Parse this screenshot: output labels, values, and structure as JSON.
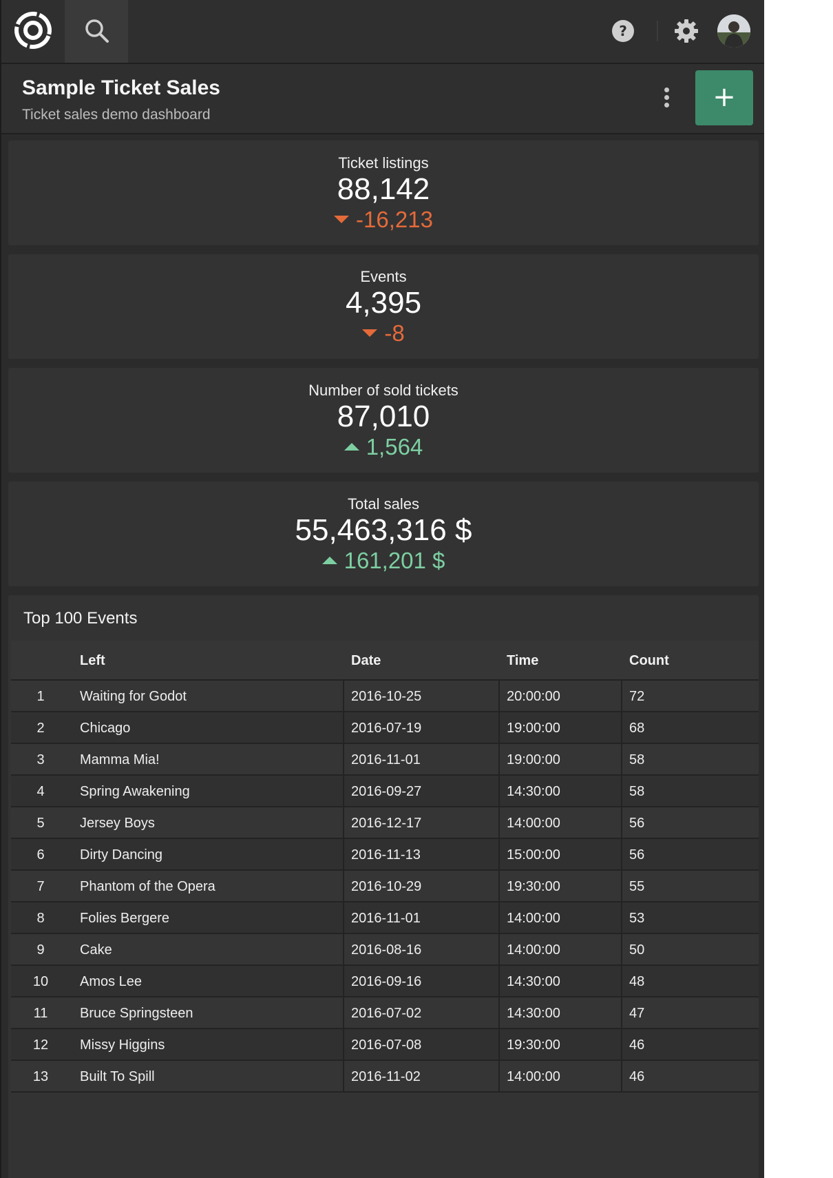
{
  "topbar": {
    "logo_icon": "app-logo-icon",
    "search_icon": "search-icon",
    "help_icon": "help-icon",
    "settings_icon": "gear-icon",
    "avatar_icon": "user-avatar"
  },
  "header": {
    "title": "Sample Ticket Sales",
    "subtitle": "Ticket sales demo dashboard",
    "add_label": "+"
  },
  "kpis": [
    {
      "label": "Ticket listings",
      "value": "88,142",
      "delta": "-16,213",
      "direction": "down"
    },
    {
      "label": "Events",
      "value": "4,395",
      "delta": "-8",
      "direction": "down"
    },
    {
      "label": "Number of sold tickets",
      "value": "87,010",
      "delta": "1,564",
      "direction": "up"
    },
    {
      "label": "Total sales",
      "value": "55,463,316 $",
      "delta": "161,201 $",
      "direction": "up"
    }
  ],
  "table": {
    "title": "Top 100 Events",
    "columns": [
      "",
      "Left",
      "Date",
      "Time",
      "Count"
    ],
    "rows": [
      [
        "1",
        "Waiting for Godot",
        "2016-10-25",
        "20:00:00",
        "72"
      ],
      [
        "2",
        "Chicago",
        "2016-07-19",
        "19:00:00",
        "68"
      ],
      [
        "3",
        "Mamma Mia!",
        "2016-11-01",
        "19:00:00",
        "58"
      ],
      [
        "4",
        "Spring Awakening",
        "2016-09-27",
        "14:30:00",
        "58"
      ],
      [
        "5",
        "Jersey Boys",
        "2016-12-17",
        "14:00:00",
        "56"
      ],
      [
        "6",
        "Dirty Dancing",
        "2016-11-13",
        "15:00:00",
        "56"
      ],
      [
        "7",
        "Phantom of the Opera",
        "2016-10-29",
        "19:30:00",
        "55"
      ],
      [
        "8",
        "Folies Bergere",
        "2016-11-01",
        "14:00:00",
        "53"
      ],
      [
        "9",
        "Cake",
        "2016-08-16",
        "14:00:00",
        "50"
      ],
      [
        "10",
        "Amos Lee",
        "2016-09-16",
        "14:30:00",
        "48"
      ],
      [
        "11",
        "Bruce Springsteen",
        "2016-07-02",
        "14:30:00",
        "47"
      ],
      [
        "12",
        "Missy Higgins",
        "2016-07-08",
        "19:30:00",
        "46"
      ],
      [
        "13",
        "Built To Spill",
        "2016-11-02",
        "14:00:00",
        "46"
      ]
    ]
  },
  "colors": {
    "background": "#2b2b2b",
    "card": "#333333",
    "accent_green": "#3d8a6a",
    "delta_down": "#e56a3a",
    "delta_up": "#7dcfa2"
  }
}
